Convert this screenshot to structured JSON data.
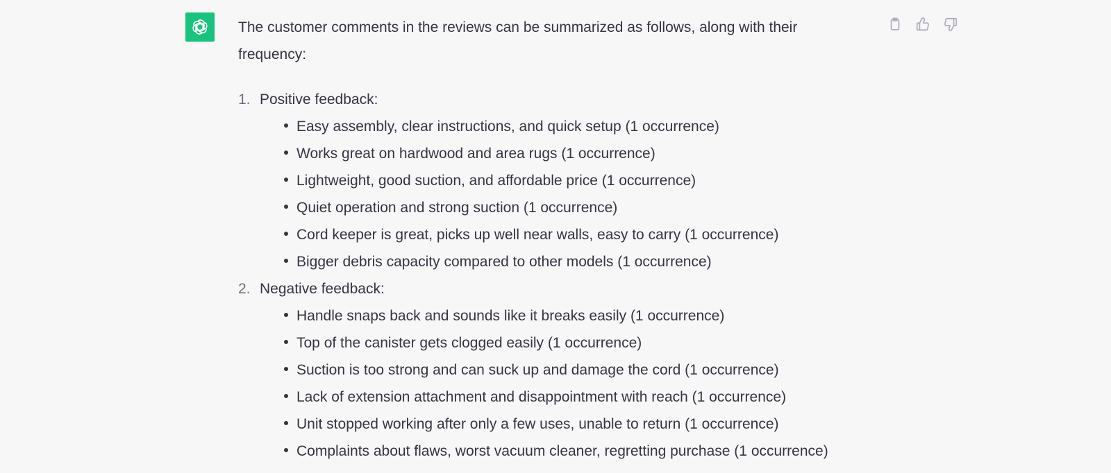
{
  "assistant": {
    "avatar_icon": "openai-logo-icon",
    "accent_color": "#19c37d"
  },
  "message": {
    "intro": "The customer comments in the reviews can be summarized as follows, along with their frequency:",
    "sections": [
      {
        "number": "1.",
        "title": "Positive feedback:",
        "items": [
          "Easy assembly, clear instructions, and quick setup (1 occurrence)",
          "Works great on hardwood and area rugs (1 occurrence)",
          "Lightweight, good suction, and affordable price (1 occurrence)",
          "Quiet operation and strong suction (1 occurrence)",
          "Cord keeper is great, picks up well near walls, easy to carry (1 occurrence)",
          "Bigger debris capacity compared to other models (1 occurrence)"
        ]
      },
      {
        "number": "2.",
        "title": "Negative feedback:",
        "items": [
          "Handle snaps back and sounds like it breaks easily (1 occurrence)",
          "Top of the canister gets clogged easily (1 occurrence)",
          "Suction is too strong and can suck up and damage the cord (1 occurrence)",
          "Lack of extension attachment and disappointment with reach (1 occurrence)",
          "Unit stopped working after only a few uses, unable to return (1 occurrence)",
          "Complaints about flaws, worst vacuum cleaner, regretting purchase (1 occurrence)"
        ]
      }
    ]
  },
  "actions": [
    {
      "icon": "clipboard-icon"
    },
    {
      "icon": "thumbs-up-icon"
    },
    {
      "icon": "thumbs-down-icon"
    }
  ]
}
